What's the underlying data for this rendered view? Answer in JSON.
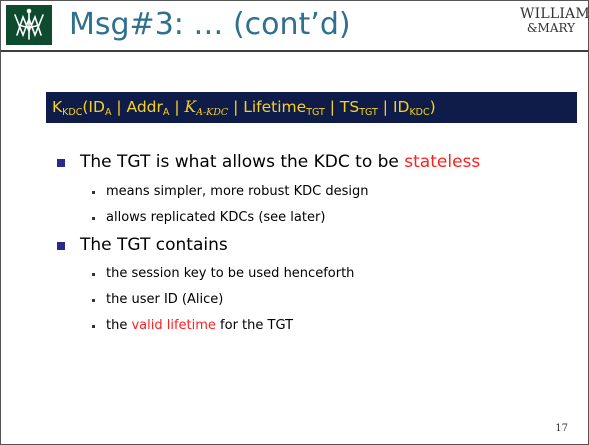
{
  "header": {
    "title": "Msg#3: … (cont’d)",
    "logo_icon": "william-and-mary-cypher-icon",
    "brand_line1": "WILLIAM",
    "brand_line2": "&MARY"
  },
  "formula": {
    "k": "K",
    "k_sub": "KDC",
    "open": "(",
    "id": "ID",
    "id_sub": "A",
    "sep1": " | ",
    "addr": "Addr",
    "addr_sub": "A",
    "sep2": " | ",
    "key": "K",
    "key_sub": "A-KDC",
    "sep3": " | ",
    "lifetime": "Lifetime",
    "lifetime_sub": "TGT",
    "sep4": " | ",
    "ts": "TS",
    "ts_sub": "TGT",
    "sep5": " | ",
    "id2": "ID",
    "id2_sub": "KDC",
    "close": ")"
  },
  "bullets": [
    {
      "pre": "The TGT is what allows the KDC to be ",
      "highlight": "stateless",
      "subs": [
        {
          "text": "means simpler, more robust KDC design"
        },
        {
          "text": "allows replicated KDCs (see later)"
        }
      ]
    },
    {
      "pre": "The TGT contains",
      "highlight": "",
      "subs": [
        {
          "pre": "the session key to be used henceforth",
          "highlight": "",
          "post": ""
        },
        {
          "pre": "the user ID (Alice)",
          "highlight": "",
          "post": ""
        },
        {
          "pre": "the ",
          "highlight": "valid lifetime",
          "post": " for the TGT"
        }
      ]
    }
  ],
  "page_number": "17",
  "colors": {
    "title": "#2f6f8f",
    "banner_bg": "#0f1c4a",
    "banner_text": "#f5d21e",
    "highlight": "#ff2020",
    "bullet": "#2a2a8a",
    "logo_bg": "#0d4a2e"
  }
}
